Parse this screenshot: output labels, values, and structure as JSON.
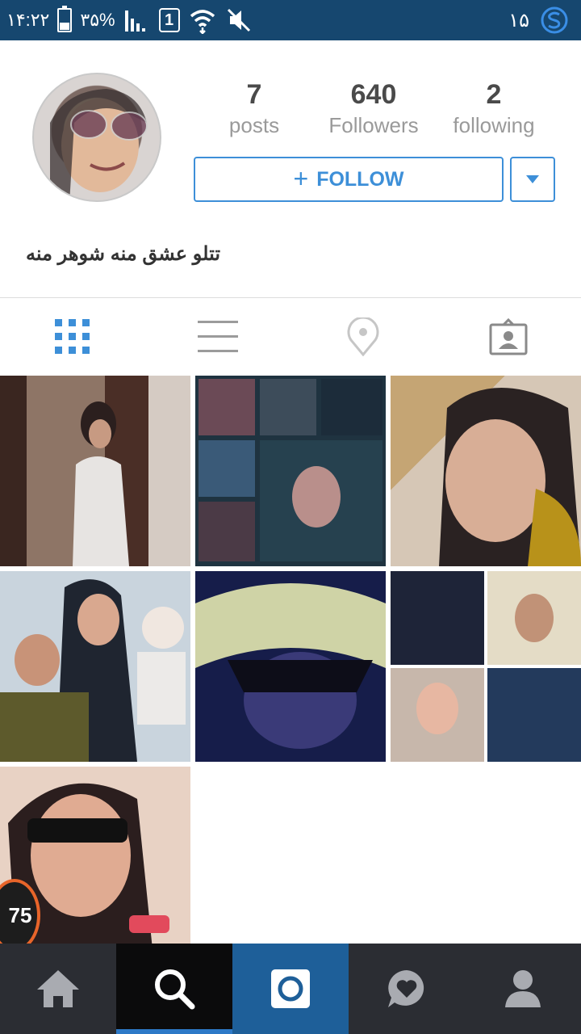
{
  "status_bar": {
    "time": "۱۴:۲۲",
    "battery": "۳۵%",
    "battery_level": 0.35,
    "sim_label": "1",
    "right_text": "۱۵",
    "icons": [
      "battery-icon",
      "signal-icon",
      "sim-icon",
      "wifi-icon",
      "mute-icon",
      "app-s-icon"
    ]
  },
  "profile": {
    "stats": [
      {
        "value": "7",
        "label": "posts"
      },
      {
        "value": "640",
        "label": "Followers"
      },
      {
        "value": "2",
        "label": "following"
      }
    ],
    "follow_button": {
      "icon": "+",
      "label": "FOLLOW"
    },
    "bio": "تتلو عشق منه شوهر منه"
  },
  "view_tabs": [
    {
      "icon": "grid-icon",
      "active": true
    },
    {
      "icon": "list-icon",
      "active": false
    },
    {
      "icon": "location-pin-icon",
      "active": false
    },
    {
      "icon": "tagged-person-icon",
      "active": false
    }
  ],
  "photos_count_shown": 7,
  "floating_badge": "75",
  "bottom_nav": [
    {
      "icon": "home-icon"
    },
    {
      "icon": "search-icon",
      "active": true
    },
    {
      "icon": "camera-icon"
    },
    {
      "icon": "activity-heart-icon"
    },
    {
      "icon": "profile-icon"
    }
  ],
  "colors": {
    "status_bar": "#16476f",
    "accent": "#3d8fd8",
    "nav_bg": "#2b2d33",
    "nav_camera": "#1e5f99",
    "badge_ring": "#e8652a"
  }
}
